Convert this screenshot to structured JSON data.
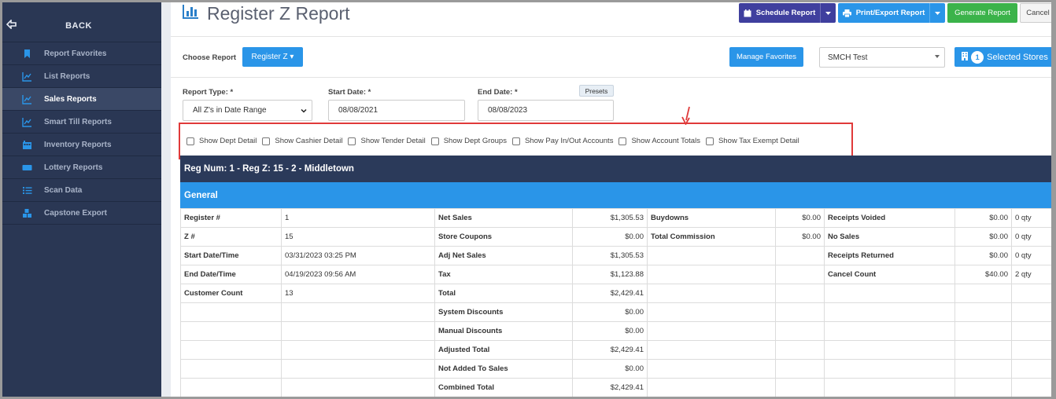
{
  "sidebar": {
    "back_label": "BACK",
    "items": [
      {
        "label": "Report Favorites",
        "icon": "bookmark-icon",
        "active": false
      },
      {
        "label": "List Reports",
        "icon": "line-chart-icon",
        "active": false
      },
      {
        "label": "Sales Reports",
        "icon": "line-chart-icon",
        "active": true
      },
      {
        "label": "Smart Till Reports",
        "icon": "line-chart-icon",
        "active": false
      },
      {
        "label": "Inventory Reports",
        "icon": "inventory-icon",
        "active": false
      },
      {
        "label": "Lottery Reports",
        "icon": "ticket-icon",
        "active": false
      },
      {
        "label": "Scan Data",
        "icon": "list-icon",
        "active": false
      },
      {
        "label": "Capstone Export",
        "icon": "cubes-icon",
        "active": false
      }
    ]
  },
  "header": {
    "title": "Register Z Report",
    "schedule_label": "Schedule Report",
    "print_label": "Print/Export Report",
    "generate_label": "Generate Report",
    "cancel_label": "Cancel"
  },
  "choose": {
    "label": "Choose Report",
    "register_label": "Register Z ▾",
    "favorites_label": "Manage Favorites",
    "store_value": "SMCH Test",
    "selected_count": "1",
    "selected_label": "Selected Stores"
  },
  "filters": {
    "report_type_label": "Report Type: *",
    "report_type_value": "All Z's in Date Range",
    "start_label": "Start Date: *",
    "start_value": "08/08/2021",
    "end_label": "End Date: *",
    "end_value": "08/08/2023",
    "presets_label": "Presets"
  },
  "checkboxes": [
    "Show Dept Detail",
    "Show Cashier Detail",
    "Show Tender Detail",
    "Show Dept Groups",
    "Show Pay In/Out Accounts",
    "Show Account Totals",
    "Show Tax Exempt Detail"
  ],
  "report": {
    "reg_header": "Reg Num: 1 - Reg Z: 15 - 2 - Middletown",
    "section": "General",
    "rows": [
      [
        "Register #",
        "1",
        "Net Sales",
        "$1,305.53",
        "Buydowns",
        "$0.00",
        "Receipts Voided",
        "$0.00",
        "0 qty"
      ],
      [
        "Z #",
        "15",
        "Store Coupons",
        "$0.00",
        "Total Commission",
        "$0.00",
        "No Sales",
        "$0.00",
        "0 qty"
      ],
      [
        "Start Date/Time",
        "03/31/2023 03:25 PM",
        "Adj Net Sales",
        "$1,305.53",
        "",
        "",
        "Receipts Returned",
        "$0.00",
        "0 qty"
      ],
      [
        "End Date/Time",
        "04/19/2023 09:56 AM",
        "Tax",
        "$1,123.88",
        "",
        "",
        "Cancel Count",
        "$40.00",
        "2 qty"
      ],
      [
        "Customer Count",
        "13",
        "Total",
        "$2,429.41",
        "",
        "",
        "",
        "",
        ""
      ],
      [
        "",
        "",
        "System Discounts",
        "$0.00",
        "",
        "",
        "",
        "",
        ""
      ],
      [
        "",
        "",
        "Manual Discounts",
        "$0.00",
        "",
        "",
        "",
        "",
        ""
      ],
      [
        "",
        "",
        "Adjusted Total",
        "$2,429.41",
        "",
        "",
        "",
        "",
        ""
      ],
      [
        "",
        "",
        "Not Added To Sales",
        "$0.00",
        "",
        "",
        "",
        "",
        ""
      ],
      [
        "",
        "",
        "Combined Total",
        "$2,429.41",
        "",
        "",
        "",
        "",
        ""
      ]
    ]
  }
}
